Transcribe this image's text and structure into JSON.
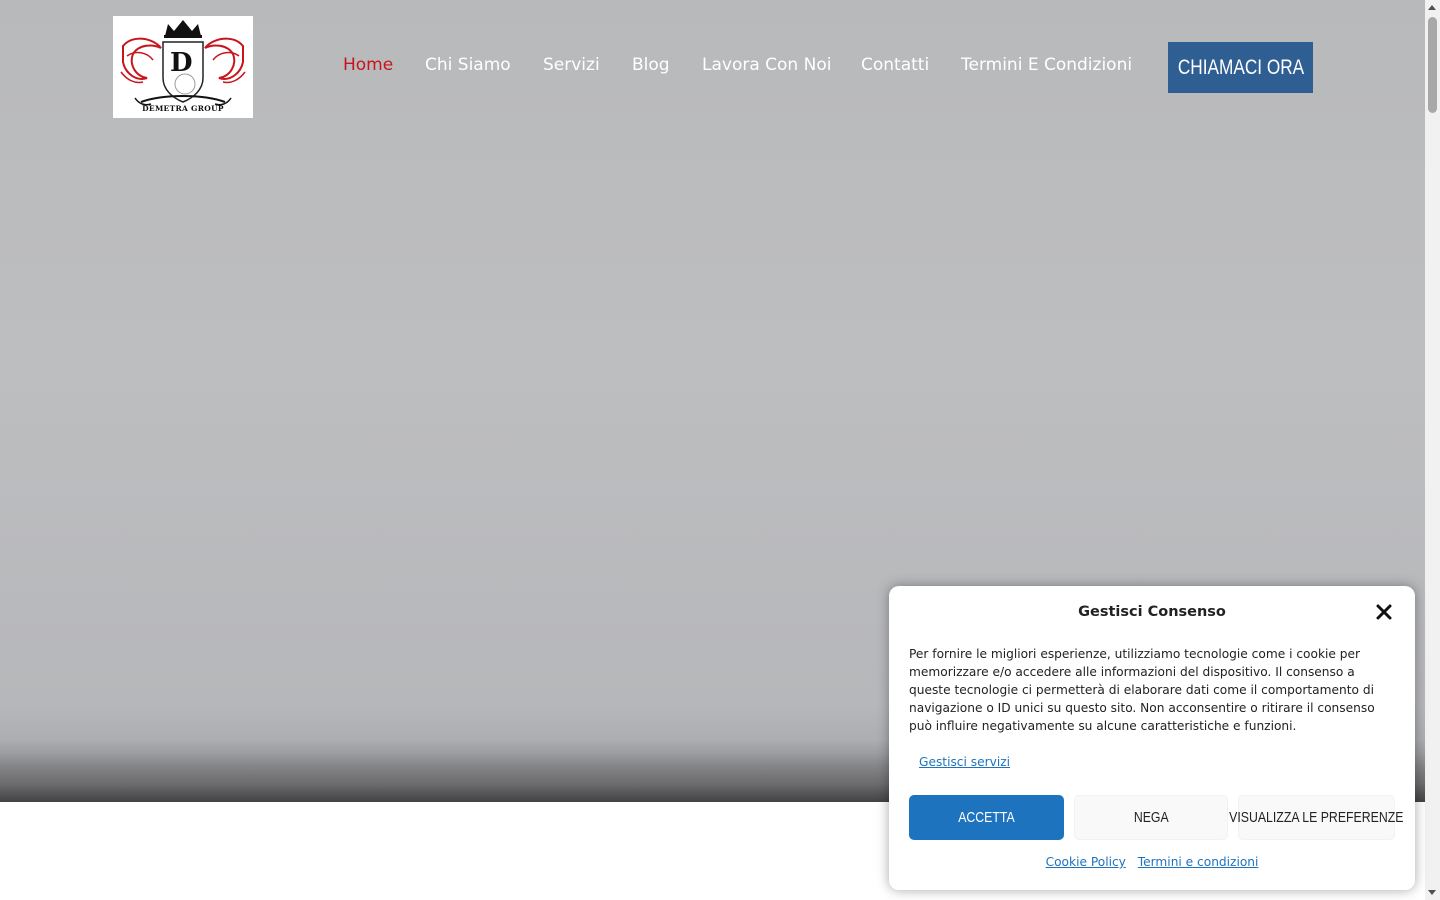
{
  "header": {
    "logo_text": "DEMETRA GROUP",
    "logo_monogram": "D",
    "nav": [
      {
        "label": "Home",
        "active": true
      },
      {
        "label": "Chi Siamo",
        "active": false
      },
      {
        "label": "Servizi",
        "active": false
      },
      {
        "label": "Blog",
        "active": false
      },
      {
        "label": "Lavora Con Noi",
        "active": false
      },
      {
        "label": "Contatti",
        "active": false
      },
      {
        "label": "Termini E Condizioni",
        "active": false
      }
    ],
    "cta_label": "CHIAMACI ORA"
  },
  "consent": {
    "title": "Gestisci Consenso",
    "body": "Per fornire le migliori esperienze, utilizziamo tecnologie come i cookie per memorizzare e/o accedere alle informazioni del dispositivo. Il consenso a queste tecnologie ci permetterà di elaborare dati come il comportamento di navigazione o ID unici su questo sito. Non acconsentire o ritirare il consenso può influire negativamente su alcune caratteristiche e funzioni.",
    "manage_services": "Gestisci servizi",
    "accept_label": "ACCETTA",
    "deny_label": "NEGA",
    "preferences_label": "VISUALIZZA LE PREFERENZE",
    "links": {
      "cookie_policy": "Cookie Policy",
      "terms": "Termini e condizioni"
    },
    "close_icon": "close-icon"
  },
  "colors": {
    "accent_red": "#c8151b",
    "cta_blue": "#2f5f92",
    "accept_blue": "#1e73be",
    "hero_gray": "#bdbec0"
  }
}
